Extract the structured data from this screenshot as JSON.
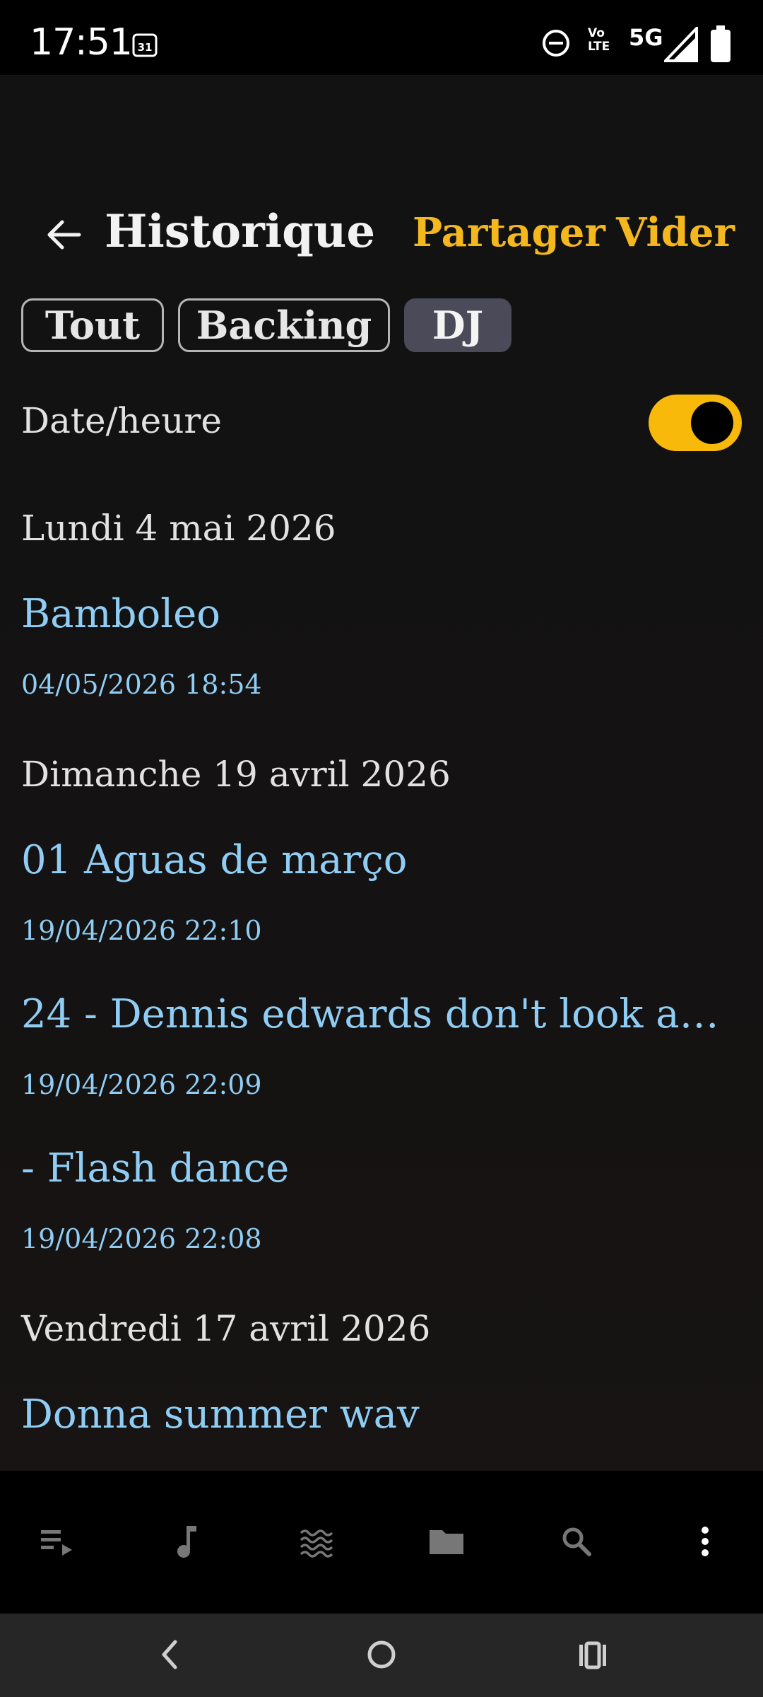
{
  "status": {
    "time": "17:51",
    "calendar_badge": "31",
    "volte_top": "Vo",
    "volte_bottom": "LTE",
    "network": "5G"
  },
  "header": {
    "title": "Historique",
    "share_label": "Partager",
    "clear_label": "Vider"
  },
  "filters": {
    "all": "Tout",
    "backing": "Backing",
    "dj": "DJ",
    "selected": "DJ"
  },
  "toggle": {
    "label": "Date/heure",
    "on": true,
    "accent": "#f9b90b"
  },
  "history": {
    "groups": [
      {
        "date": "Lundi 4 mai 2026",
        "items": [
          {
            "title": "Bamboleo",
            "timestamp": "04/05/2026 18:54"
          }
        ]
      },
      {
        "date": "Dimanche 19 avril 2026",
        "items": [
          {
            "title": "01 Aguas de março",
            "timestamp": "19/04/2026 22:10"
          },
          {
            "title": "24 - Dennis edwards   don't look an...",
            "timestamp": "19/04/2026 22:09"
          },
          {
            "title": "- Flash dance",
            "timestamp": "19/04/2026 22:08"
          }
        ]
      },
      {
        "date": "Vendredi 17 avril 2026",
        "items": [
          {
            "title": "Donna summer wav",
            "timestamp": ""
          }
        ]
      }
    ]
  },
  "toolbar": {
    "icons": [
      "queue-icon",
      "music-note-icon",
      "waves-icon",
      "folder-icon",
      "search-icon",
      "more-vert-icon"
    ]
  },
  "colors": {
    "accent_yellow": "#f4b81e",
    "link_blue": "#8fcdf4",
    "chip_selected": "#4a4a58"
  }
}
